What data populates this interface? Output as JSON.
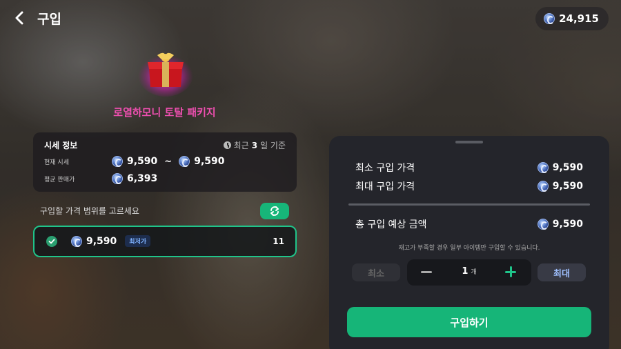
{
  "header": {
    "title": "구입",
    "balance": "24,915"
  },
  "item": {
    "name": "로열하모니 토탈 패키지",
    "icon": "red-gift-chest-icon"
  },
  "market": {
    "title": "시세 정보",
    "period_prefix": "최근 ",
    "period_days": "3",
    "period_suffix": "일 기준",
    "current_label": "현재 시세",
    "current_min": "9,590",
    "current_max": "9,590",
    "avg_label": "평균 판매가",
    "avg_value": "6,393"
  },
  "range": {
    "label": "구입할 가격 범위를 고르세요",
    "option": {
      "price": "9,590",
      "badge": "최저가",
      "count": "11"
    }
  },
  "purchase": {
    "min_price_label": "최소 구입 가격",
    "min_price": "9,590",
    "max_price_label": "최대 구입 가격",
    "max_price": "9,590",
    "total_label": "총 구입 예상 금액",
    "total": "9,590",
    "notice": "재고가 부족할 경우 일부 아이템만 구입할 수 있습니다.",
    "min_button": "최소",
    "quantity": "1",
    "unit": "개",
    "max_button": "최대",
    "buy_button": "구입하기"
  },
  "colors": {
    "accent": "#16b578",
    "item_name": "#ee4fb0",
    "badge_text": "#7fb3ff"
  }
}
